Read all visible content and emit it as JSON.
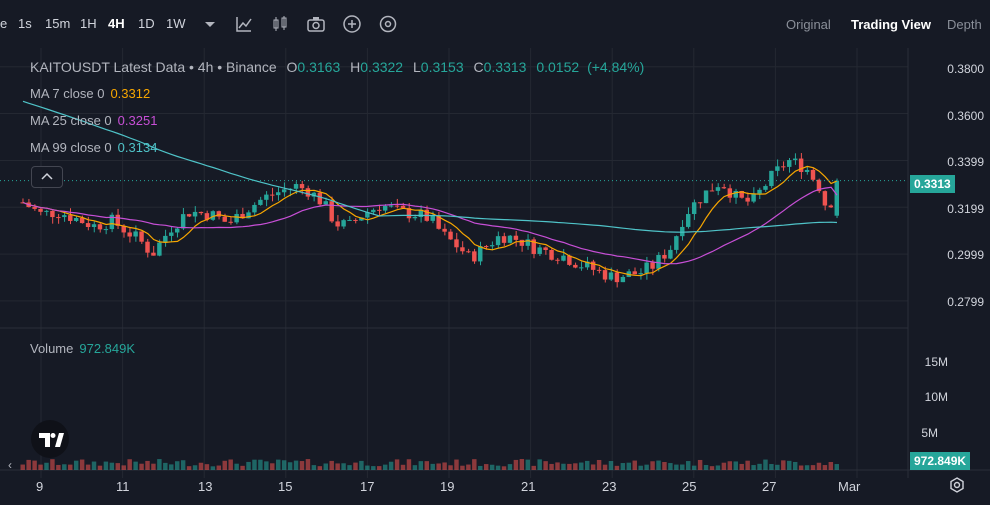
{
  "toolbar": {
    "intervals": [
      "1s",
      "15m",
      "1H",
      "4H",
      "1D",
      "1W"
    ],
    "active_interval": "4H",
    "right_tabs": [
      "Original",
      "Trading View",
      "Depth"
    ],
    "active_tab": "Trading View"
  },
  "legend": {
    "title": "KAITOUSDT Latest Data • 4h • Binance",
    "o_label": "O",
    "o": "0.3163",
    "h_label": "H",
    "h": "0.3322",
    "l_label": "L",
    "l": "0.3153",
    "c_label": "C",
    "c": "0.3313",
    "change": "0.0152",
    "change_pct": "(+4.84%)",
    "ma7_label": "MA 7 close 0",
    "ma7": "0.3312",
    "ma25_label": "MA 25 close 0",
    "ma25": "0.3251",
    "ma99_label": "MA 99 close 0",
    "ma99": "0.3134",
    "volume_label": "Volume",
    "volume": "972.849K"
  },
  "price_axis": [
    "0.3800",
    "0.3600",
    "0.3399",
    "0.3199",
    "0.2999",
    "0.2799"
  ],
  "volume_axis": [
    "15M",
    "10M",
    "5M"
  ],
  "date_axis": [
    "9",
    "11",
    "13",
    "15",
    "17",
    "19",
    "21",
    "23",
    "25",
    "27",
    "Mar"
  ],
  "last_price": "0.3313",
  "last_volume": "972.849K",
  "colors": {
    "up": "#26a69a",
    "down": "#ef5350",
    "ma7": "#f7a600",
    "ma25": "#c74fd6",
    "ma99": "#4fc3c8",
    "bg": "#161a25"
  },
  "chart_data": {
    "type": "candlestick",
    "price_range": [
      0.27,
      0.388
    ],
    "volume_range": [
      0,
      18000000
    ],
    "candles_count": 138,
    "last_candle": {
      "open": 0.3163,
      "high": 0.3322,
      "low": 0.3153,
      "close": 0.3313
    },
    "ma7_last": 0.3312,
    "ma25_last": 0.3251,
    "ma99_last": 0.3134,
    "volume_last": 972849,
    "close_trend": [
      [
        0,
        0.322
      ],
      [
        4,
        0.317
      ],
      [
        8,
        0.318
      ],
      [
        12,
        0.315
      ],
      [
        16,
        0.312
      ],
      [
        20,
        0.314
      ],
      [
        26,
        0.306
      ],
      [
        29,
        0.3
      ],
      [
        33,
        0.311
      ],
      [
        37,
        0.318
      ],
      [
        42,
        0.317
      ],
      [
        46,
        0.313
      ],
      [
        50,
        0.319
      ],
      [
        54,
        0.324
      ],
      [
        58,
        0.327
      ],
      [
        61,
        0.329
      ],
      [
        64,
        0.327
      ],
      [
        67,
        0.322
      ],
      [
        70,
        0.313
      ],
      [
        73,
        0.312
      ],
      [
        76,
        0.317
      ],
      [
        80,
        0.321
      ],
      [
        84,
        0.318
      ],
      [
        88,
        0.317
      ],
      [
        91,
        0.315
      ],
      [
        94,
        0.308
      ],
      [
        98,
        0.302
      ],
      [
        100,
        0.298
      ],
      [
        104,
        0.304
      ],
      [
        107,
        0.308
      ],
      [
        111,
        0.306
      ],
      [
        114,
        0.303
      ],
      [
        117,
        0.301
      ],
      [
        121,
        0.299
      ],
      [
        124,
        0.296
      ],
      [
        128,
        0.293
      ],
      [
        132,
        0.29
      ],
      [
        135,
        0.291
      ],
      [
        138,
        0.292
      ],
      [
        141,
        0.295
      ],
      [
        145,
        0.303
      ],
      [
        148,
        0.317
      ],
      [
        152,
        0.325
      ],
      [
        156,
        0.331
      ],
      [
        160,
        0.323
      ],
      [
        163,
        0.322
      ],
      [
        167,
        0.332
      ],
      [
        171,
        0.34
      ],
      [
        175,
        0.337
      ],
      [
        178,
        0.329
      ],
      [
        180,
        0.318
      ],
      [
        182,
        0.3313
      ]
    ]
  }
}
